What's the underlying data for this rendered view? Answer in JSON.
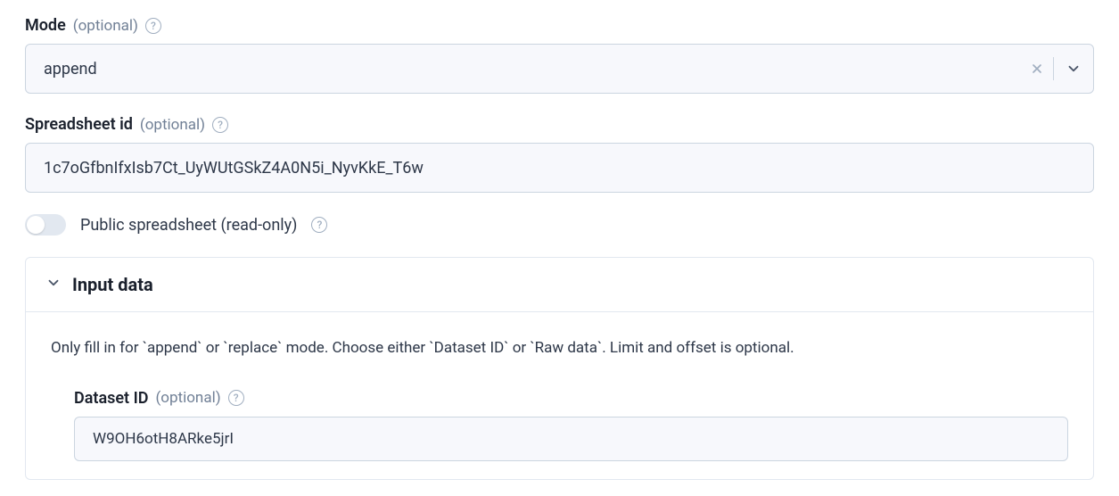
{
  "mode": {
    "label": "Mode",
    "optional": "(optional)",
    "value": "append"
  },
  "spreadsheet": {
    "label": "Spreadsheet id",
    "optional": "(optional)",
    "value": "1c7oGfbnIfxIsb7Ct_UyWUtGSkZ4A0N5i_NyvKkE_T6w"
  },
  "public_toggle": {
    "label": "Public spreadsheet (read-only)"
  },
  "input_data": {
    "title": "Input data",
    "desc": "Only fill in for `append` or `replace` mode. Choose either `Dataset ID` or `Raw data`. Limit and offset is optional.",
    "dataset_id": {
      "label": "Dataset ID",
      "optional": "(optional)",
      "value": "W9OH6otH8ARke5jrI"
    }
  }
}
